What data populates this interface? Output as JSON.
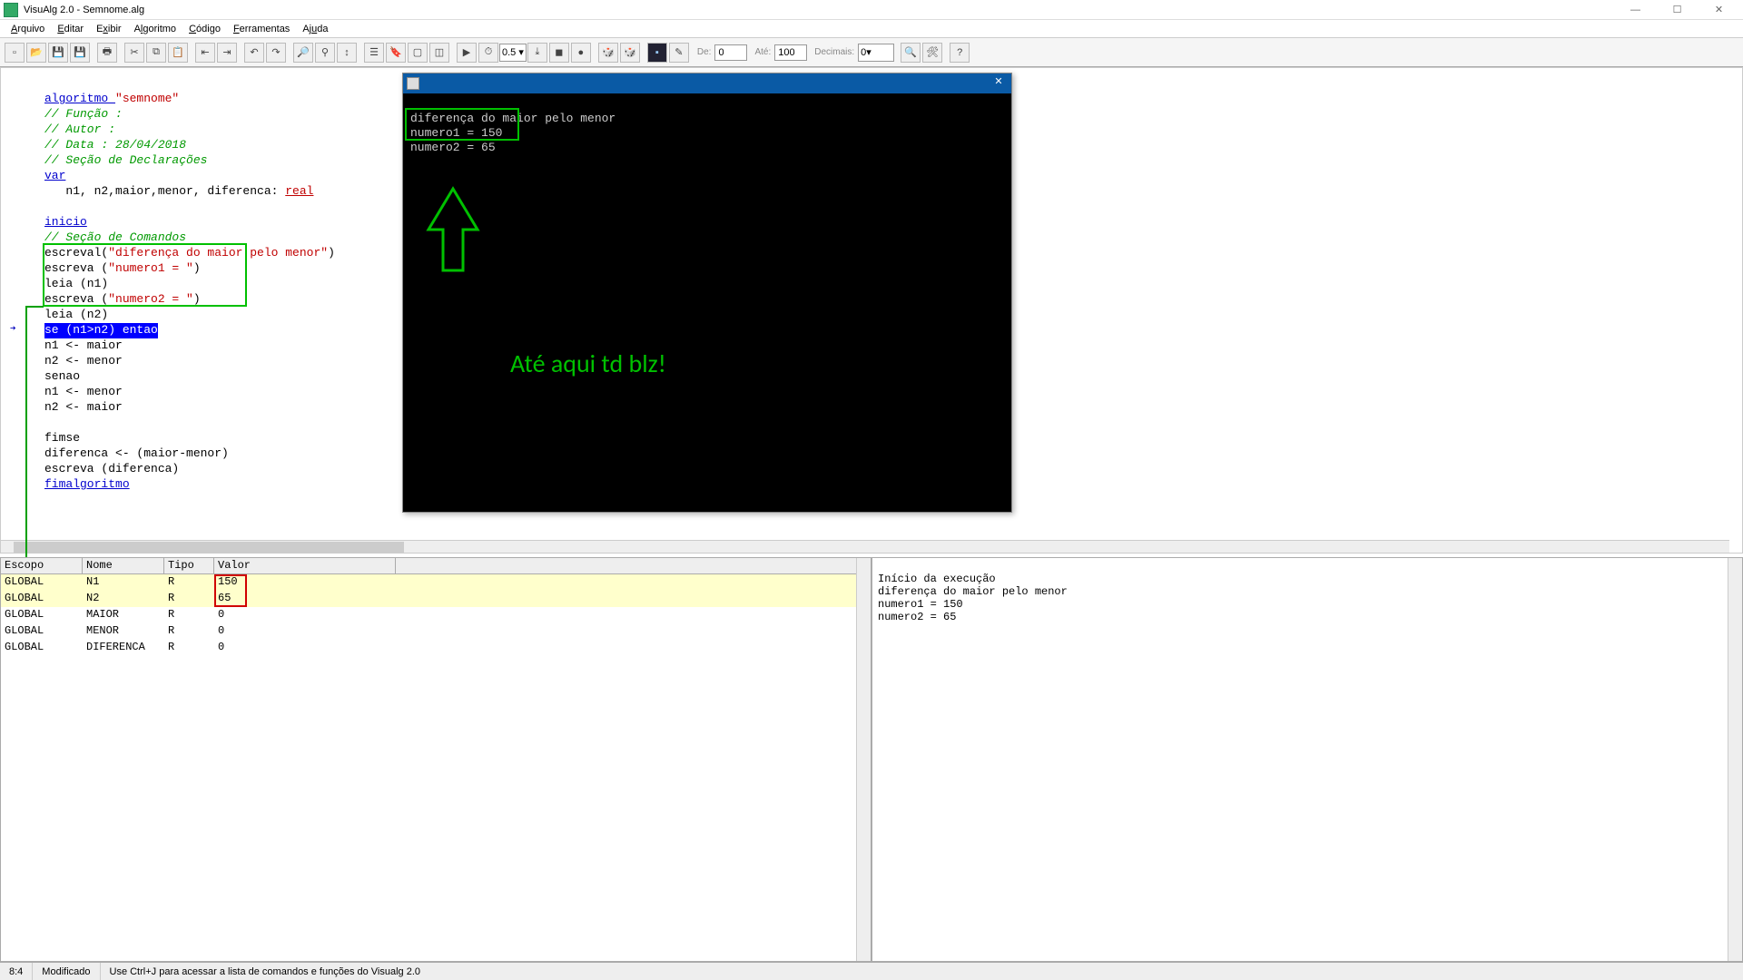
{
  "app": {
    "title": "VisuAlg 2.0 - Semnome.alg"
  },
  "menu": [
    "Arquivo",
    "Editar",
    "Exibir",
    "Algoritmo",
    "Código",
    "Ferramentas",
    "Ajuda"
  ],
  "toolbar": {
    "timer_value": "0.5 ▾",
    "de_label": "De:",
    "de_val": "0",
    "ate_label": "Até:",
    "ate_val": "100",
    "dec_label": "Decimais:",
    "dec_val": "0"
  },
  "code": {
    "l1_kw": "algoritmo ",
    "l1_str": "\"semnome\"",
    "l2": "// Função :",
    "l3": "// Autor :",
    "l4": "// Data : 28/04/2018",
    "l5": "// Seção de Declarações",
    "l6": "var",
    "l7": "   n1, n2,maior,menor, diferenca: ",
    "l7_type": "real",
    "l8": "",
    "l9": "inicio",
    "l10": "// Seção de Comandos",
    "l11a": "escreval(",
    "l11b": "\"diferença do maior pelo menor\"",
    "l11c": ")",
    "l12a": "escreva (",
    "l12b": "\"numero1 = \"",
    "l12c": ")",
    "l13": "leia (n1)",
    "l14a": "escreva (",
    "l14b": "\"numero2 = \"",
    "l14c": ")",
    "l15": "leia (n2)",
    "l16": "se (n1>n2) entao",
    "l17": "n1 <- maior",
    "l18": "n2 <- menor",
    "l19": "senao",
    "l20": "n1 <- menor",
    "l21": "n2 <- maior",
    "l22": "",
    "l23": "fimse",
    "l24": "diferenca <- (maior-menor)",
    "l25": "escreva (diferenca)",
    "l26": "fimalgoritmo"
  },
  "console": {
    "l1": "diferença do maior pelo menor",
    "l2": "numero1 = 150",
    "l3": "numero2 = 65"
  },
  "annotation": "Até aqui td blz!",
  "vars": {
    "headers": [
      "Escopo",
      "Nome",
      "Tipo",
      "Valor"
    ],
    "rows": [
      {
        "escopo": "GLOBAL",
        "nome": "N1",
        "tipo": "R",
        "valor": "150",
        "hl": true
      },
      {
        "escopo": "GLOBAL",
        "nome": "N2",
        "tipo": "R",
        "valor": "65",
        "hl": true
      },
      {
        "escopo": "GLOBAL",
        "nome": "MAIOR",
        "tipo": "R",
        "valor": "0",
        "hl": false
      },
      {
        "escopo": "GLOBAL",
        "nome": "MENOR",
        "tipo": "R",
        "valor": "0",
        "hl": false
      },
      {
        "escopo": "GLOBAL",
        "nome": "DIFERENCA",
        "tipo": "R",
        "valor": "0",
        "hl": false
      }
    ]
  },
  "log": [
    "Início da execução",
    "diferença do maior pelo menor",
    "numero1 = 150",
    "numero2 = 65"
  ],
  "status": {
    "pos": "8:4",
    "state": "Modificado",
    "hint": "Use Ctrl+J para acessar a lista de comandos e funções do Visualg 2.0"
  },
  "icons": {
    "min": "—",
    "max": "☐",
    "close": "✕",
    "console_close": "✕"
  }
}
